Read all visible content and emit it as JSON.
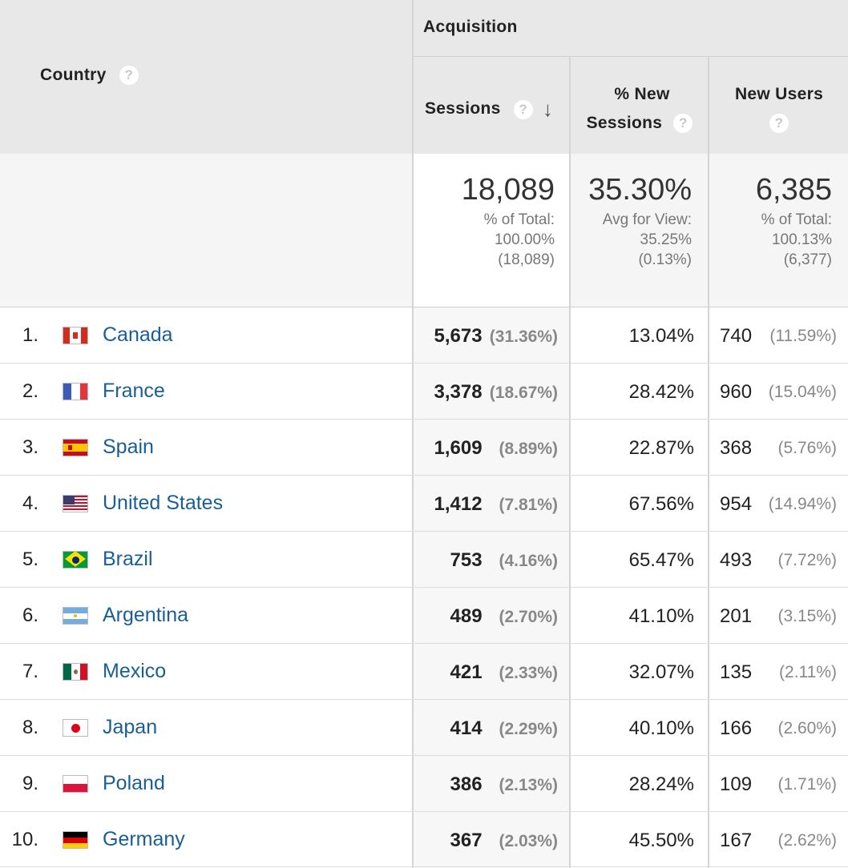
{
  "header": {
    "country_label": "Country",
    "group_label": "Acquisition",
    "sessions_label": "Sessions",
    "pct_new_label_1": "% New",
    "pct_new_label_2": "Sessions",
    "new_users_label": "New Users",
    "help_glyph": "?",
    "sort_glyph": "↓"
  },
  "summary": {
    "sessions": {
      "value": "18,089",
      "line1": "% of Total:",
      "line2": "100.00%",
      "line3": "(18,089)"
    },
    "pct_new": {
      "value": "35.30%",
      "line1": "Avg for View:",
      "line2": "35.25%",
      "line3": "(0.13%)"
    },
    "new_users": {
      "value": "6,385",
      "line1": "% of Total:",
      "line2": "100.13%",
      "line3": "(6,377)"
    }
  },
  "rows": [
    {
      "rank": "1.",
      "country": "Canada",
      "flag": "canada-flag-icon",
      "sessions": "5,673",
      "sessions_pct": "(31.36%)",
      "pct_new": "13.04%",
      "new_users": "740",
      "new_users_pct": "(11.59%)"
    },
    {
      "rank": "2.",
      "country": "France",
      "flag": "france-flag-icon",
      "sessions": "3,378",
      "sessions_pct": "(18.67%)",
      "pct_new": "28.42%",
      "new_users": "960",
      "new_users_pct": "(15.04%)"
    },
    {
      "rank": "3.",
      "country": "Spain",
      "flag": "spain-flag-icon",
      "sessions": "1,609",
      "sessions_pct": "(8.89%)",
      "pct_new": "22.87%",
      "new_users": "368",
      "new_users_pct": "(5.76%)"
    },
    {
      "rank": "4.",
      "country": "United States",
      "flag": "usa-flag-icon",
      "sessions": "1,412",
      "sessions_pct": "(7.81%)",
      "pct_new": "67.56%",
      "new_users": "954",
      "new_users_pct": "(14.94%)"
    },
    {
      "rank": "5.",
      "country": "Brazil",
      "flag": "brazil-flag-icon",
      "sessions": "753",
      "sessions_pct": "(4.16%)",
      "pct_new": "65.47%",
      "new_users": "493",
      "new_users_pct": "(7.72%)"
    },
    {
      "rank": "6.",
      "country": "Argentina",
      "flag": "argentina-flag-icon",
      "sessions": "489",
      "sessions_pct": "(2.70%)",
      "pct_new": "41.10%",
      "new_users": "201",
      "new_users_pct": "(3.15%)"
    },
    {
      "rank": "7.",
      "country": "Mexico",
      "flag": "mexico-flag-icon",
      "sessions": "421",
      "sessions_pct": "(2.33%)",
      "pct_new": "32.07%",
      "new_users": "135",
      "new_users_pct": "(2.11%)"
    },
    {
      "rank": "8.",
      "country": "Japan",
      "flag": "japan-flag-icon",
      "sessions": "414",
      "sessions_pct": "(2.29%)",
      "pct_new": "40.10%",
      "new_users": "166",
      "new_users_pct": "(2.60%)"
    },
    {
      "rank": "9.",
      "country": "Poland",
      "flag": "poland-flag-icon",
      "sessions": "386",
      "sessions_pct": "(2.13%)",
      "pct_new": "28.24%",
      "new_users": "109",
      "new_users_pct": "(1.71%)"
    },
    {
      "rank": "10.",
      "country": "Germany",
      "flag": "germany-flag-icon",
      "sessions": "367",
      "sessions_pct": "(2.03%)",
      "pct_new": "45.50%",
      "new_users": "167",
      "new_users_pct": "(2.62%)"
    }
  ],
  "colors": {
    "link": "#1a5e96",
    "header_bg": "#e8e8e8",
    "summary_bg": "#f5f5f5",
    "sorted_col_bg": "#f7f7f7"
  }
}
